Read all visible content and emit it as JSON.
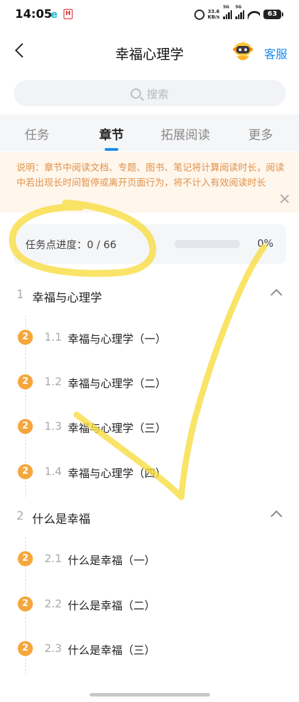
{
  "status_bar": {
    "time": "14:05",
    "app1": "e",
    "app2": "H",
    "speed_top": "33.6",
    "speed_bottom": "KB/s",
    "sim1": "5G",
    "sim2": "5G",
    "battery": "63"
  },
  "nav": {
    "title": "幸福心理学",
    "service_label": "客服"
  },
  "search": {
    "placeholder": "搜索"
  },
  "tabs": [
    {
      "label": "任务",
      "active": false
    },
    {
      "label": "章节",
      "active": true
    },
    {
      "label": "拓展阅读",
      "active": false
    },
    {
      "label": "更多",
      "active": false
    }
  ],
  "notice": {
    "text": "说明：章节中阅读文档、专题、图书、笔记将计算阅读时长，阅读中若出现长时间暂停或离开页面行为，将不计入有效阅读时长"
  },
  "progress": {
    "label": "任务点进度：0 / 66",
    "percent_text": "0%",
    "fraction": 0
  },
  "chapters": [
    {
      "num": "1",
      "title": "幸福与心理学",
      "sections": [
        {
          "badge": "2",
          "num": "1.1",
          "title": "幸福与心理学（一）"
        },
        {
          "badge": "2",
          "num": "1.2",
          "title": "幸福与心理学（二）"
        },
        {
          "badge": "2",
          "num": "1.3",
          "title": "幸福与心理学（三）"
        },
        {
          "badge": "2",
          "num": "1.4",
          "title": "幸福与心理学（四）"
        }
      ]
    },
    {
      "num": "2",
      "title": "什么是幸福",
      "sections": [
        {
          "badge": "2",
          "num": "2.1",
          "title": "什么是幸福（一）"
        },
        {
          "badge": "2",
          "num": "2.2",
          "title": "什么是幸福（二）"
        },
        {
          "badge": "2",
          "num": "2.3",
          "title": "什么是幸福（三）"
        }
      ]
    }
  ],
  "colors": {
    "accent": "#1a8cf0",
    "badge": "#f5a63c",
    "notice_text": "#e0924a",
    "highlighter": "#f7dc3e"
  }
}
